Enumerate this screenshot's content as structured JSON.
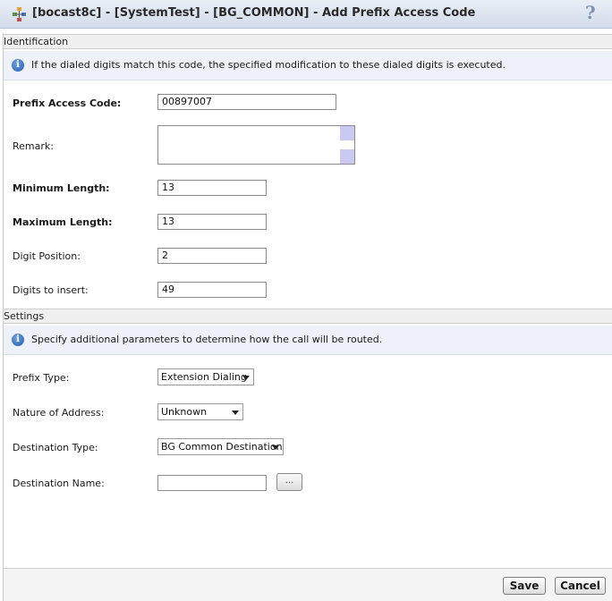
{
  "window": {
    "title": "[bocast8c] - [SystemTest] - [BG_COMMON] - Add Prefix Access Code",
    "help_symbol": "?"
  },
  "identification": {
    "section_title": "Identification",
    "info_text": "If the dialed digits match this code, the specified modification to these dialed digits is executed.",
    "fields": {
      "prefix_access_code": {
        "label": "Prefix Access Code:",
        "value": "00897007"
      },
      "remark": {
        "label": "Remark:",
        "value": ""
      },
      "minimum_length": {
        "label": "Minimum Length:",
        "value": "13"
      },
      "maximum_length": {
        "label": "Maximum Length:",
        "value": "13"
      },
      "digit_position": {
        "label": "Digit Position:",
        "value": "2"
      },
      "digits_to_insert": {
        "label": "Digits to insert:",
        "value": "49"
      }
    }
  },
  "settings": {
    "section_title": "Settings",
    "info_text": "Specify additional parameters to determine how the call will be routed.",
    "fields": {
      "prefix_type": {
        "label": "Prefix Type:",
        "value": "Extension Dialing"
      },
      "nature_of_address": {
        "label": "Nature of Address:",
        "value": "Unknown"
      },
      "destination_type": {
        "label": "Destination Type:",
        "value": "BG Common Destination"
      },
      "destination_name": {
        "label": "Destination Name:",
        "value": "",
        "browse_label": "..."
      }
    }
  },
  "footer": {
    "save_label": "Save",
    "cancel_label": "Cancel"
  },
  "icons": {
    "info": "info-icon",
    "app": "tree-network-icon",
    "help": "help-icon"
  }
}
